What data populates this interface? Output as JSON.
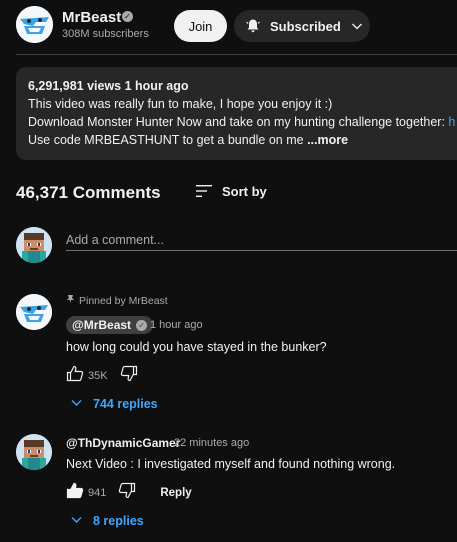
{
  "channel": {
    "name": "MrBeast",
    "subscribers": "308M subscribers",
    "join_label": "Join",
    "subscribed_label": "Subscribed"
  },
  "description": {
    "meta": "6,291,981 views  1 hour ago",
    "line1": "This video was really fun to make, I hope you enjoy it :)",
    "line2": "Download Monster Hunter Now and take on my hunting challenge together: ",
    "line2_link": "h",
    "line3": "Use code MRBEASTHUNT to get a bundle on me",
    "more_label": "...more"
  },
  "comments_header": {
    "count": "46,371 Comments",
    "sort_label": "Sort by"
  },
  "add_comment": {
    "placeholder": "Add a comment..."
  },
  "comments": [
    {
      "pinned_by": "Pinned by MrBeast",
      "author": "@MrBeast",
      "time": "1 hour ago",
      "text": "how long could you have stayed in the bunker?",
      "likes": "35K",
      "replies_label": "744 replies"
    },
    {
      "author": "@ThDynamicGamer",
      "time": "22 minutes ago",
      "text": "Next Video : I investigated myself and found nothing wrong.",
      "likes": "941",
      "reply_label": "Reply",
      "replies_label": "8 replies"
    }
  ],
  "colors": {
    "background": "#0f0f0f",
    "surface": "#272727",
    "link_blue": "#3ea6ff",
    "muted_text": "#aaaaaa"
  },
  "icons": [
    "verified-icon",
    "bell-icon",
    "chevron-down-icon",
    "sort-icon",
    "pin-icon",
    "like-icon",
    "dislike-icon"
  ]
}
